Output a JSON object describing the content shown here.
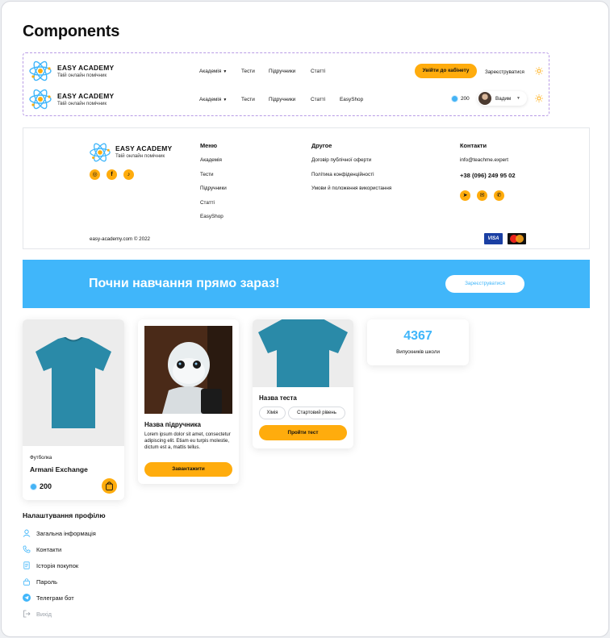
{
  "page_title": "Components",
  "brand": {
    "name": "EASY ACADEMY",
    "tagline": "Твій онлайн помічник"
  },
  "header1": {
    "nav": [
      "Академія",
      "Тести",
      "Підручники",
      "Статті"
    ],
    "login_button": "Увійти до кабінету",
    "register_link": "Зареєструватися"
  },
  "header2": {
    "nav": [
      "Академія",
      "Тести",
      "Підручники",
      "Статті",
      "EasyShop"
    ],
    "coins": "200",
    "user_name": "Вадим"
  },
  "footer": {
    "menu_title": "Меню",
    "menu_items": [
      "Академія",
      "Тести",
      "Підручники",
      "Статті",
      "EasyShop"
    ],
    "other_title": "Другое",
    "other_items": [
      "Договір публічної оферти",
      "Політика конфіденційності",
      "Умови й положення використання"
    ],
    "contacts_title": "Контакти",
    "email": "info@teachme.expert",
    "phone": "+38 (096) 249 95 02",
    "copyright": "easy-academy.com © 2022",
    "payment_visa": "VISA"
  },
  "banner": {
    "text": "Почни навчання прямо зараз!",
    "button": "Зареєструватися"
  },
  "product_card": {
    "category": "Футболка",
    "name": "Armani Exchange",
    "price": "200"
  },
  "guide_card": {
    "title": "Назва підручника",
    "text": "Lorem ipsum dolor sit amet, consectetur adipiscing elit. Etiam eu turpis molestie, dictum est a, mattis tellus.",
    "button": "Завантажити"
  },
  "test_card": {
    "title": "Назва теста",
    "tags": [
      "Хімія",
      "Стартовий рівень"
    ],
    "button": "Пройти тест"
  },
  "stat_card": {
    "number": "4367",
    "label": "Випускників школи"
  },
  "profile": {
    "title": "Налаштування профілю",
    "items": [
      "Загальна інформація",
      "Контакти",
      "Історія покупок",
      "Пароль",
      "Телеграм бот",
      "Вихід"
    ]
  },
  "colors": {
    "accent": "#ffac0d",
    "primary_blue": "#40b6fa",
    "shirt": "#2a8aa8"
  }
}
